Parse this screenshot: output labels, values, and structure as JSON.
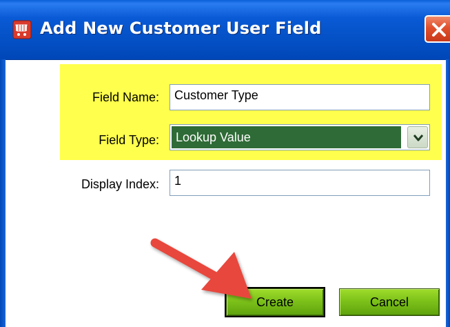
{
  "window": {
    "title": "Add New Customer User Field",
    "icon": "shopping-cart-icon",
    "close_icon": "close-icon"
  },
  "form": {
    "field_name": {
      "label": "Field Name:",
      "value": "Customer Type"
    },
    "field_type": {
      "label": "Field Type:",
      "selected": "Lookup Value",
      "dropdown_icon": "chevron-down-icon"
    },
    "display_index": {
      "label": "Display Index:",
      "value": "1"
    }
  },
  "buttons": {
    "create_label": "Create",
    "cancel_label": "Cancel"
  },
  "annotations": {
    "highlight_color": "#ffff4d",
    "arrow_color": "#e8463c",
    "arrow_target": "create-button"
  },
  "colors": {
    "titlebar": "#0552c8",
    "selection": "#2f6b36",
    "button_green": "#7dc21a"
  }
}
